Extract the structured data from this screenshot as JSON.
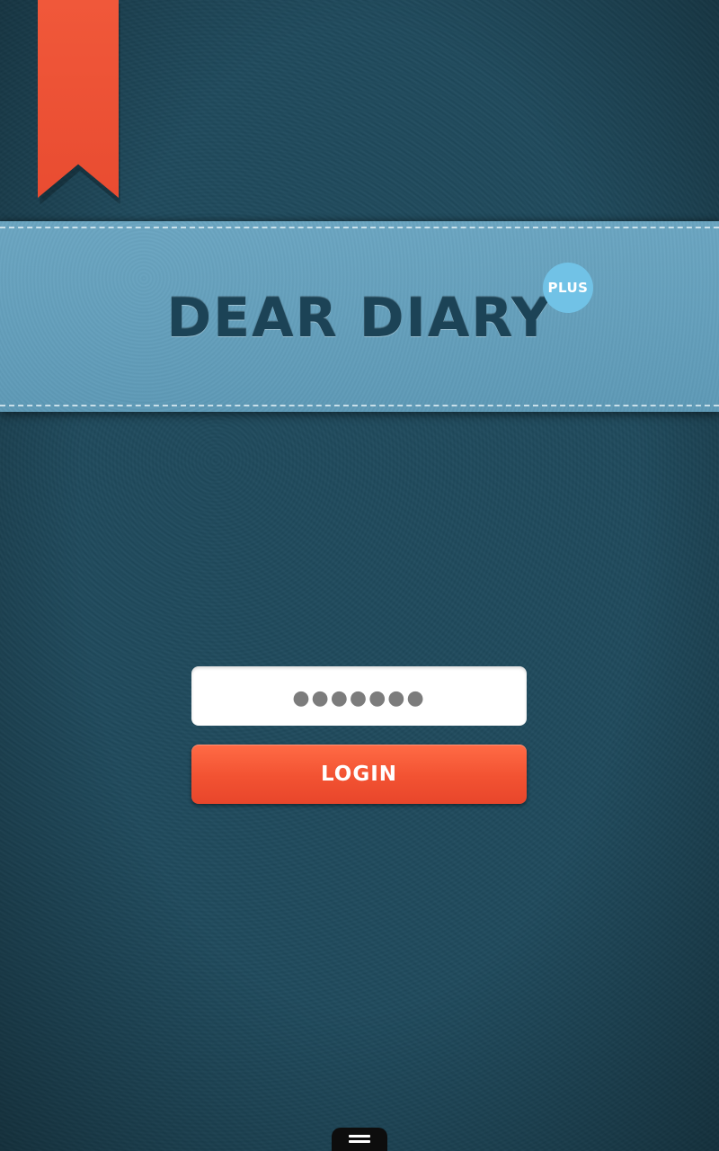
{
  "app": {
    "title": "DEAR DIARY",
    "badge": "PLUS"
  },
  "login": {
    "password_value": "●●●●●●●",
    "button_label": "LOGIN"
  },
  "colors": {
    "background": "#1f4a5d",
    "banner": "#6ba6c2",
    "bookmark": "#e94c31",
    "badge": "#71c2e6",
    "button": "#f25232"
  },
  "icons": {
    "bookmark": "bookmark-ribbon",
    "nav_handle": "menu-handle-icon"
  }
}
